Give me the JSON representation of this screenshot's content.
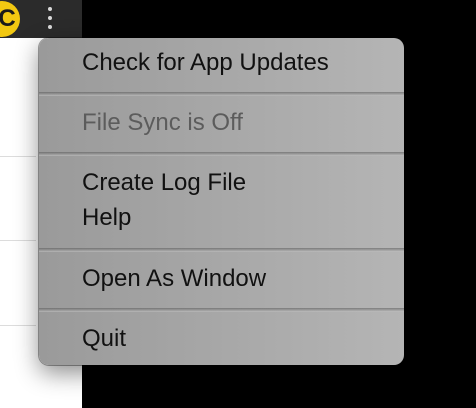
{
  "app": {
    "avatar_letter": "C",
    "brand_color": "#f2c811",
    "toolbar_color": "#2b2b2b",
    "more_icon": "kebab-vertical-icon"
  },
  "menu": {
    "items": [
      {
        "label": "Check for App Updates",
        "enabled": true
      },
      {
        "label": "File Sync is Off",
        "enabled": false
      },
      {
        "label": "Create Log File",
        "enabled": true
      },
      {
        "label": "Help",
        "enabled": true
      },
      {
        "label": "Open As Window",
        "enabled": true
      },
      {
        "label": "Quit",
        "enabled": true
      }
    ]
  }
}
